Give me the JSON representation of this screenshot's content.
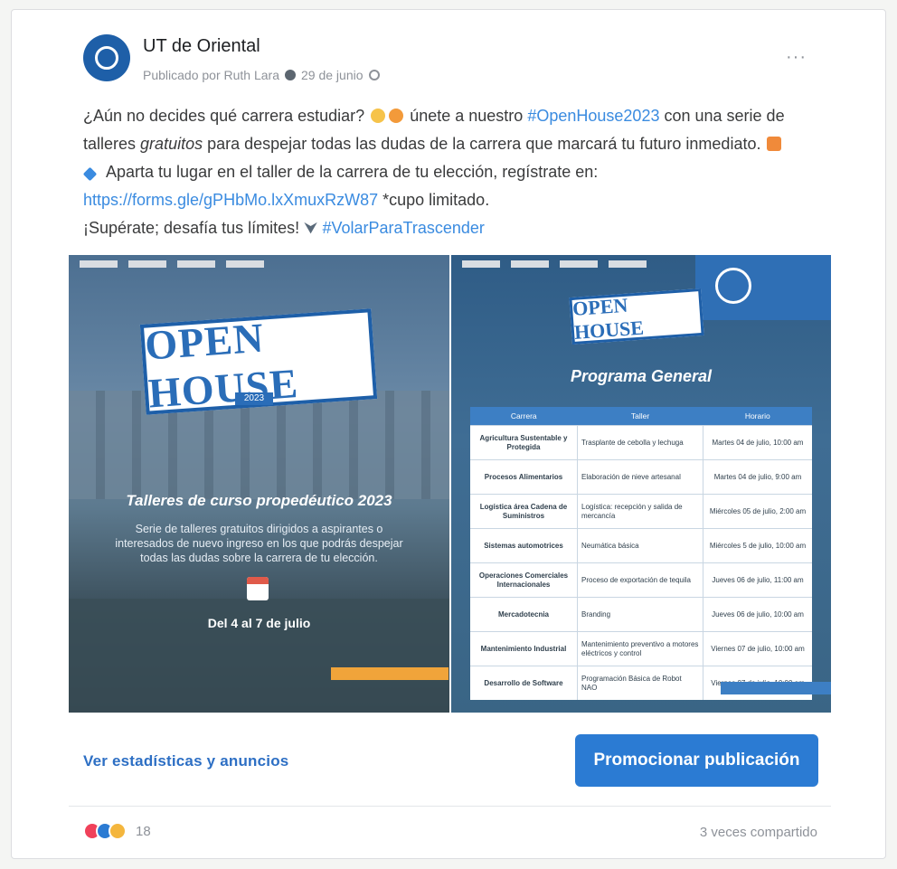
{
  "post": {
    "page_name": "UT de Oriental",
    "meta_author": "Publicado por Ruth Lara",
    "meta_date": "29 de junio",
    "text": {
      "l1_a": "¿Aún no decides qué carrera estudiar?",
      "l1_b": "únete a nuestro",
      "l1_tag": "#OpenHouse2023",
      "l1_c": "con una serie de",
      "l2_a": "talleres",
      "l2_em": "gratuitos",
      "l2_b": "para despejar todas las dudas de la carrera que marcará tu futuro inmediato.",
      "l3": "Aparta tu lugar en el taller de la carrera de tu elección, regístrate en:",
      "l4_link": "https://forms.gle/gPHbMo.lxXmuxRzW87",
      "l4_b": "*cupo limitado.",
      "l5_a": "¡Supérate; desafía tus límites!",
      "l5_tag": "#VolarParaTrascender"
    }
  },
  "media": {
    "left": {
      "badge": "OPEN HOUSE",
      "year": "2023",
      "title": "Talleres de curso propedéutico 2023",
      "description": "Serie de talleres gratuitos dirigidos a aspirantes o interesados de nuevo ingreso en los que podrás despejar todas las dudas sobre la carrera de tu elección.",
      "dates": "Del 4 al 7 de julio"
    },
    "right": {
      "badge": "OPEN HOUSE",
      "title": "Programa General",
      "headers": [
        "Carrera",
        "Taller",
        "Horario"
      ],
      "rows": [
        [
          "Agricultura Sustentable y Protegida",
          "Trasplante de cebolla y lechuga",
          "Martes 04 de julio, 10:00 am"
        ],
        [
          "Procesos Alimentarios",
          "Elaboración de nieve artesanal",
          "Martes 04 de julio, 9:00 am"
        ],
        [
          "Logística área Cadena de Suministros",
          "Logística: recepción y salida de mercancía",
          "Miércoles 05 de julio, 2:00 am"
        ],
        [
          "Sistemas automotrices",
          "Neumática básica",
          "Miércoles 5 de julio, 10:00 am"
        ],
        [
          "Operaciones Comerciales Internacionales",
          "Proceso de exportación de tequila",
          "Jueves 06 de julio, 11:00 am"
        ],
        [
          "Mercadotecnia",
          "Branding",
          "Jueves 06 de julio, 10:00 am"
        ],
        [
          "Mantenimiento Industrial",
          "Mantenimiento preventivo a motores eléctricos y control",
          "Viernes 07 de julio, 10:00 am"
        ],
        [
          "Desarrollo de Software",
          "Programación Básica de Robot NAO",
          "Viernes 07 de julio, 10:00 am"
        ]
      ]
    }
  },
  "actions": {
    "stats_link": "Ver estadísticas y anuncios",
    "promote_button": "Promocionar publicación"
  },
  "footer": {
    "reaction_count": "18",
    "shares": "3 veces compartido"
  },
  "colors": {
    "accent": "#2b7bd3",
    "hashtag": "#3a8be0"
  }
}
